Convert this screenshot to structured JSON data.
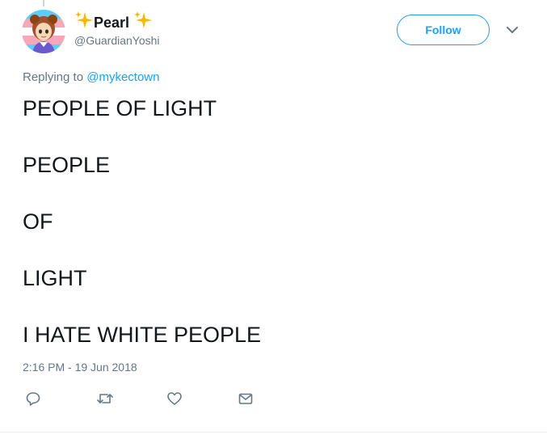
{
  "tweet": {
    "display_name": "Pearl",
    "username": "@GuardianYoshi",
    "follow_label": "Follow",
    "replying_prefix": "Replying to",
    "replying_handle": "@mykectown",
    "lines": [
      "PEOPLE OF LIGHT",
      "PEOPLE",
      "OF",
      "LIGHT",
      "I HATE WHITE PEOPLE"
    ],
    "timestamp": "2:16 PM - 19 Jun 2018"
  },
  "icons": {
    "sparkles": "sparkles-icon",
    "menu": "chevron-down-icon",
    "reply": "reply-icon",
    "retweet": "retweet-icon",
    "like": "heart-icon",
    "dm": "envelope-icon"
  },
  "colors": {
    "accent": "#1da1f2",
    "secondary_text": "#657786",
    "text": "#14171a",
    "avatar_flag_stripes": [
      "#5bcefa",
      "#f5a9b8",
      "#ffffff"
    ]
  }
}
